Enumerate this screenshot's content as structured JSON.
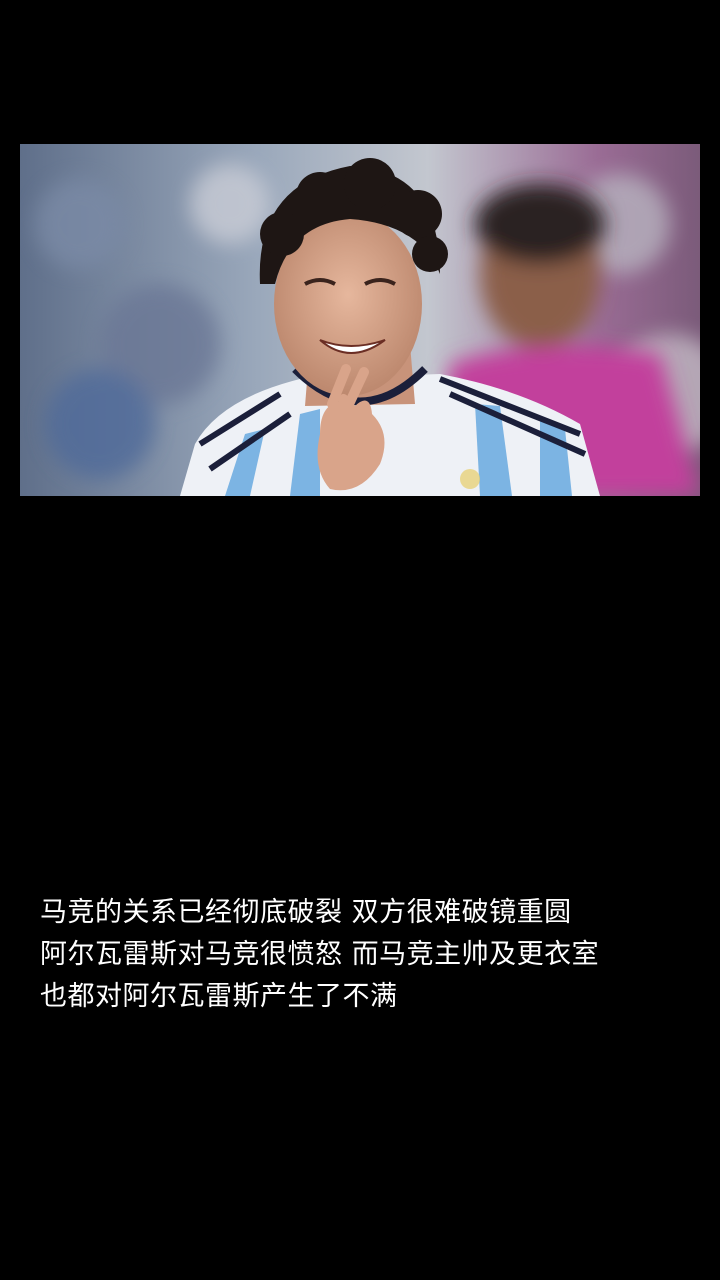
{
  "caption": {
    "lines": [
      "马竞的关系已经彻底破裂  双方很难破镜重圆",
      "阿尔瓦雷斯对马竞很愤怒  而马竞主帅及更衣室",
      "也都对阿尔瓦雷斯产生了不满"
    ]
  }
}
